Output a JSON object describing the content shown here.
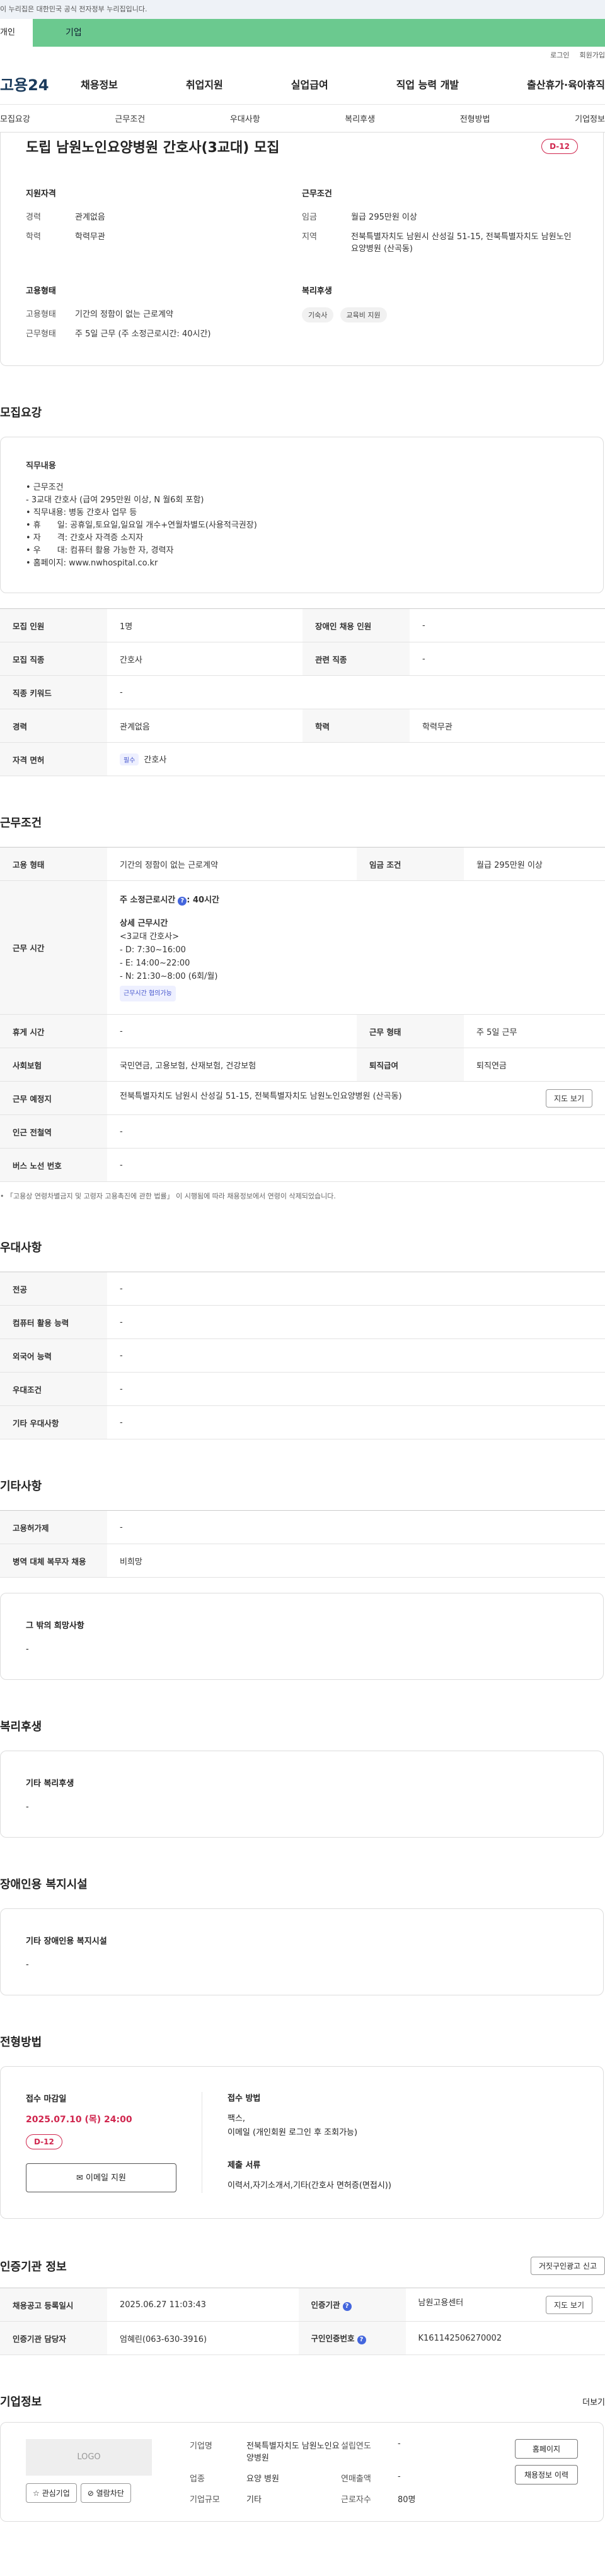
{
  "gov_banner": "이 누리집은 대한민국 공식 전자정부 누리집입니다.",
  "audience_tabs": [
    "개인",
    "기업"
  ],
  "util": [
    "로그인",
    "회원가입"
  ],
  "logo": "고용24",
  "gnb": [
    "채용정보",
    "취업지원",
    "실업급여",
    "직업 능력 개발",
    "출산휴가·육아휴직"
  ],
  "subtabs": [
    "모집요강",
    "근무조건",
    "우대사항",
    "복리후생",
    "전형방법",
    "기업정보"
  ],
  "title": "도립 남원노인요양병원 간호사(3교대) 모집",
  "dday": "D-12",
  "summary": {
    "qual_title": "지원자격",
    "qual": [
      {
        "k": "경력",
        "v": "관계없음"
      },
      {
        "k": "학력",
        "v": "학력무관"
      }
    ],
    "cond_title": "근무조건",
    "cond": [
      {
        "k": "임금",
        "v": "월급 295만원 이상"
      },
      {
        "k": "지역",
        "v": "전북특별자치도 남원시 산성길 51-15, 전북특별자치도 남원노인요양병원 (산곡동)"
      }
    ],
    "emp_title": "고용형태",
    "emp": [
      {
        "k": "고용형태",
        "v": "기간의 정함이 없는 근로계약"
      },
      {
        "k": "근무형태",
        "v": "주 5일 근무 (주 소정근로시간: 40시간)"
      }
    ],
    "welfare_title": "복리후생",
    "welfare": [
      "기숙사",
      "교육비 지원"
    ]
  },
  "recruit": {
    "section": "모집요강",
    "duty_label": "직무내용",
    "duty_lines": [
      "• 근무조건",
      "  - 3교대 간호사 (급여 295만원 이상, N 월6회 포함)",
      "• 직무내용: 병동 간호사 업무 등",
      "• 휴　　일: 공휴일,토요일,일요일 개수+연월차별도(사용적극권장)",
      "• 자　　격: 간호사 자격증 소지자",
      "• 우　　대: 컴퓨터 활용 가능한 자, 경력자",
      "• 홈페이지: www.nwhospital.co.kr"
    ],
    "rows": [
      [
        "모집 인원",
        "1명",
        "장애인 채용 인원",
        "-"
      ],
      [
        "모집 직종",
        "간호사",
        "관련 직종",
        "-"
      ],
      [
        "직종 키워드",
        "-"
      ],
      [
        "경력",
        "관계없음",
        "학력",
        "학력무관"
      ]
    ],
    "license_label": "자격 면허",
    "license_chip": "필수",
    "license": "간호사"
  },
  "work": {
    "section": "근무조건",
    "emp_label": "고용 형태",
    "emp": "기간의 정함이 없는 근로계약",
    "wage_label": "임금 조건",
    "wage": "월급 295만원 이상",
    "time_label": "근무 시간",
    "time_main": "주 소정근로시간",
    "time_hours": ": 40시간",
    "detail_label": "상세 근무시간",
    "detail_lines": [
      "<3교대 간호사>",
      " - D: 7:30~16:00",
      " - E: 14:00~22:00",
      " - N: 21:30~8:00 (6회/월)"
    ],
    "time_chip": "근무시간 협의가능",
    "rest_label": "휴게 시간",
    "rest": "-",
    "form_label": "근무 형태",
    "form": "주 5일 근무",
    "ins_label": "사회보험",
    "ins": "국민연금, 고용보험, 산재보험, 건강보험",
    "sev_label": "퇴직급여",
    "sev": "퇴직연금",
    "place_label": "근무 예정지",
    "place": "전북특별자치도 남원시 산성길 51-15, 전북특별자치도 남원노인요양병원 (산곡동)",
    "map_btn": "지도 보기",
    "station_label": "인근 전철역",
    "station": "-",
    "bus_label": "버스 노선 번호",
    "bus": "-",
    "note": "• 「고용상 연령차별금지 및 고령자 고용촉진에 관한 법률」 이 시행됨에 따라 채용정보에서 연령이 삭제되었습니다."
  },
  "pref": {
    "section": "우대사항",
    "rows": [
      [
        "전공",
        "-"
      ],
      [
        "컴퓨터 활용 능력",
        "-"
      ],
      [
        "외국어 능력",
        "-"
      ],
      [
        "우대조건",
        "-"
      ],
      [
        "기타 우대사항",
        "-"
      ]
    ]
  },
  "etc": {
    "section": "기타사항",
    "rows": [
      [
        "고용허가제",
        "-"
      ],
      [
        "병역 대체 복무자 채용",
        "비희망"
      ]
    ],
    "other_label": "그 밖의 희망사항",
    "other": "-"
  },
  "benefit": {
    "section": "복리후생",
    "label": "기타 복리후생",
    "value": "-"
  },
  "disability": {
    "section": "장애인용 복지시설",
    "label": "기타 장애인용 복지시설",
    "value": "-"
  },
  "process": {
    "section": "전형방법",
    "deadline_label": "접수 마감일",
    "deadline": "2025.07.10 (목) 24:00",
    "dday": "D-12",
    "email_btn": "이메일 지원",
    "method_label": "접수 방법",
    "method": "팩스,",
    "method2": "이메일 (개인회원 로그인 후 조회가능)",
    "docs_label": "제출 서류",
    "docs": "이력서,자기소개서,기타(간호사 면허증(면접시))"
  },
  "cert": {
    "section": "인증기관 정보",
    "report_btn": "거짓구인광고 신고",
    "reg_label": "채용공고 등록일시",
    "reg": "2025.06.27 11:03:43",
    "org_label": "인증기관",
    "org": "남원고용센터",
    "map_btn": "지도 보기",
    "mgr_label": "인증기관 담당자",
    "mgr": "엄혜린(063-630-3916)",
    "no_label": "구인인증번호",
    "no": "K161142506270002"
  },
  "company": {
    "section": "기업정보",
    "more": "더보기",
    "logo": "LOGO",
    "fav_btn": "관심기업",
    "block_btn": "열람차단",
    "name_label": "기업명",
    "name": "전북특별자치도 남원노인요양병원",
    "ind_label": "업종",
    "ind": "요양 병원",
    "size_label": "기업규모",
    "size": "기타",
    "est_label": "설립연도",
    "est": "-",
    "sales_label": "연매출액",
    "sales": "-",
    "emp_label": "근로자수",
    "emp": "80명",
    "home_btn": "홈페이지",
    "hist_btn": "채용정보 이력"
  }
}
